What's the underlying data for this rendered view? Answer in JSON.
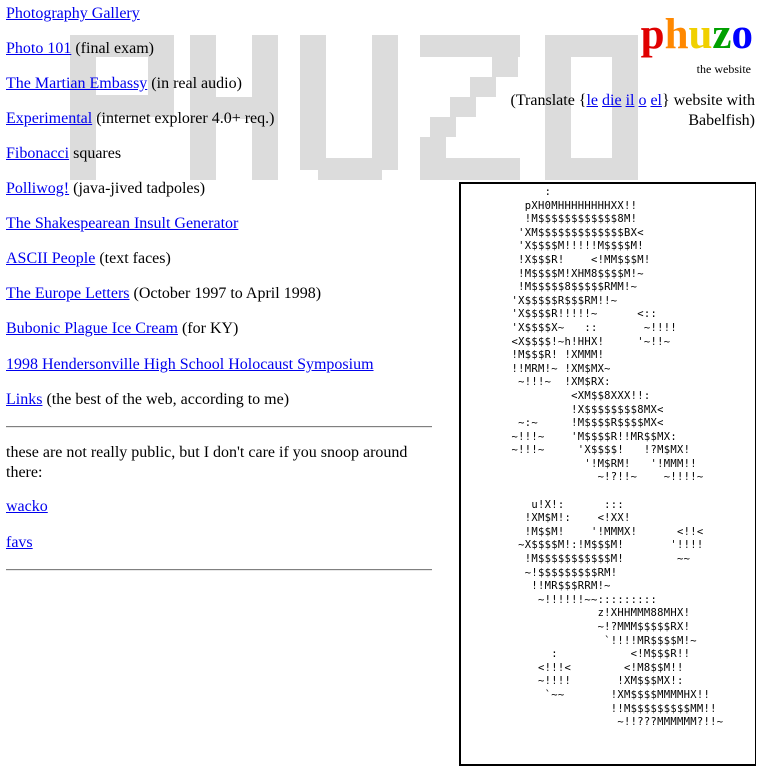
{
  "logo": {
    "letters": [
      {
        "ch": "p",
        "color": "#e00000"
      },
      {
        "ch": "h",
        "color": "#ff8800"
      },
      {
        "ch": "u",
        "color": "#f0d000"
      },
      {
        "ch": "z",
        "color": "#00a000"
      },
      {
        "ch": "o",
        "color": "#0000ff"
      }
    ],
    "tagline": "the website"
  },
  "translate": {
    "prefix": "(Translate {",
    "links": [
      "le",
      "die",
      "il",
      "o",
      "el"
    ],
    "suffix": "} website with Babelfish)"
  },
  "links": [
    {
      "label": "Photography Gallery",
      "note": ""
    },
    {
      "label": "Photo 101",
      "note": " (final exam)"
    },
    {
      "label": "The Martian Embassy",
      "note": " (in real audio)"
    },
    {
      "label": "Experimental",
      "note": " (internet explorer 4.0+ req.)"
    },
    {
      "label": "Fibonacci",
      "note": " squares"
    },
    {
      "label": "Polliwog!",
      "note": " (java-jived tadpoles)"
    },
    {
      "label": "The Shakespearean Insult Generator",
      "note": ""
    },
    {
      "label": "ASCII People",
      "note": " (text faces)"
    },
    {
      "label": "The Europe Letters",
      "note": " (October 1997 to April 1998)"
    },
    {
      "label": "Bubonic Plague Ice Cream",
      "note": " (for KY)"
    },
    {
      "label": "1998 Hendersonville High School Holocaust Symposium",
      "note": ""
    },
    {
      "label": "Links",
      "note": " (the best of the web, according to me)"
    }
  ],
  "private_note": "these are not really public, but I don't care if you snoop around there:",
  "private_links": [
    "wacko",
    "favs"
  ],
  "ascii_art": "         :\n      pXH0MHHHHHHHHXX!!\n      !M$$$$$$$$$$$$8M!\n     'XM$$$$$$$$$$$$$BX<\n     'X$$$$M!!!!!M$$$$M!\n     !X$$$R!    <!MM$$$M!\n     !M$$$$M!XHM8$$$$M!~\n     !M$$$$$8$$$$$RMM!~\n    'X$$$$$R$$$RM!!~\n    'X$$$$R!!!!!~      <::\n    'X$$$$X~   ::       ~!!!!\n    <X$$$$!~h!HHX!     '~!!~\n    !M$$$R! !XMMM!\n    !!MRM!~ !XM$MX~\n     ~!!!~  !XM$RX:\n             <XM$$8XXX!!:\n             !X$$$$$$$$8MX<\n     ~:~     !M$$$$R$$$$MX<\n    ~!!!~    'M$$$$R!!MR$$MX:\n    ~!!!~     'X$$$$!   !?M$MX!\n               '!M$RM!   '!MMM!!\n                 ~!?!!~    ~!!!!~\n\n       u!X!:      :::\n      !XM$M!:    <!XX!\n      !M$$M!    '!MMMX!      <!!<\n     ~X$$$$M!:!M$$$M!       '!!!!\n      !M$$$$$$$$$$$M!        ~~\n      ~!$$$$$$$$$RM!\n       !!MR$$$RRM!~\n        ~!!!!!!~~:::::::::\n                 z!XHHMMM88MHX!\n                 ~!?MMM$$$$$RX!\n                  `!!!!MR$$$$M!~\n          :           <!M$$$R!!\n        <!!!<        <!M8$$M!!\n        ~!!!!       !XM$$$MX!:\n         `~~       !XM$$$$MMMMHX!!\n                   !!M$$$$$$$$$MM!!\n                    ~!!???MMMMMM?!!~"
}
